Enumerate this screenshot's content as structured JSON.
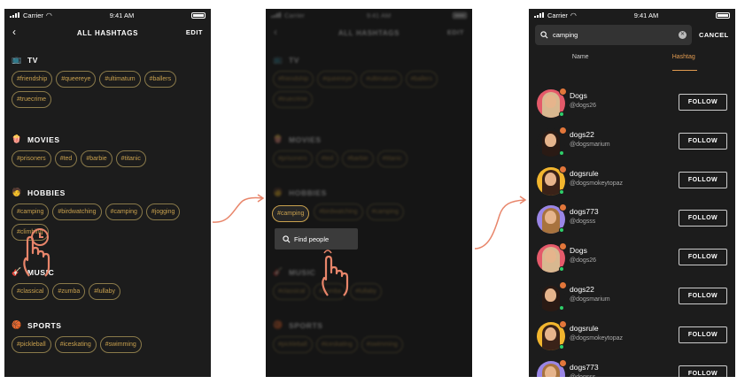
{
  "status": {
    "carrier": "Carrier",
    "time": "9:41 AM"
  },
  "screen1": {
    "title": "ALL HASHTAGS",
    "edit": "EDIT",
    "sections": [
      {
        "name": "TV",
        "icon": "tv-icon",
        "tags": [
          "#friendship",
          "#queereye",
          "#ultimatum",
          "#ballers",
          "#truecrime"
        ]
      },
      {
        "name": "MOVIES",
        "icon": "popcorn-icon",
        "tags": [
          "#prisoners",
          "#ted",
          "#barbie",
          "#titanic"
        ]
      },
      {
        "name": "HOBBIES",
        "icon": "hobby-icon",
        "tags": [
          "#camping",
          "#birdwatching",
          "#camping",
          "#jogging",
          "#climbing"
        ]
      },
      {
        "name": "MUSIC",
        "icon": "guitar-icon",
        "tags": [
          "#classical",
          "#zumba",
          "#lullaby"
        ]
      },
      {
        "name": "SPORTS",
        "icon": "ball-icon",
        "tags": [
          "#pickleball",
          "#iceskating",
          "#swimming"
        ]
      }
    ]
  },
  "screen2": {
    "selected_tag": "#camping",
    "popup_label": "Find people"
  },
  "screen3": {
    "search_value": "camping",
    "cancel": "CANCEL",
    "tabs": [
      "Name",
      "Hashtag"
    ],
    "follow_label": "FOLLOW",
    "results": [
      {
        "name": "Dogs",
        "handle": "@dogs26",
        "bg": "#e45a6a",
        "hair": "#d8b890"
      },
      {
        "name": "dogs22",
        "handle": "@dogsmarium",
        "bg": "#1c1c1c",
        "hair": "#2a1a14"
      },
      {
        "name": "dogsrule",
        "handle": "@dogsmokeytopaz",
        "bg": "#f2b62e",
        "hair": "#3a2218"
      },
      {
        "name": "dogs773",
        "handle": "@dogsss",
        "bg": "#9a86e6",
        "hair": "#a8733e"
      },
      {
        "name": "Dogs",
        "handle": "@dogs26",
        "bg": "#e45a6a",
        "hair": "#d8b890"
      },
      {
        "name": "dogs22",
        "handle": "@dogsmarium",
        "bg": "#1c1c1c",
        "hair": "#2a1a14"
      },
      {
        "name": "dogsrule",
        "handle": "@dogsmokeytopaz",
        "bg": "#f2b62e",
        "hair": "#3a2218"
      },
      {
        "name": "dogs773",
        "handle": "@dogsss",
        "bg": "#9a86e6",
        "hair": "#a8733e"
      }
    ]
  },
  "colors": {
    "accent": "#e09a50",
    "tag_text": "#c9a14e",
    "arrow": "#e8856a",
    "bg": "#1c1c1c"
  }
}
